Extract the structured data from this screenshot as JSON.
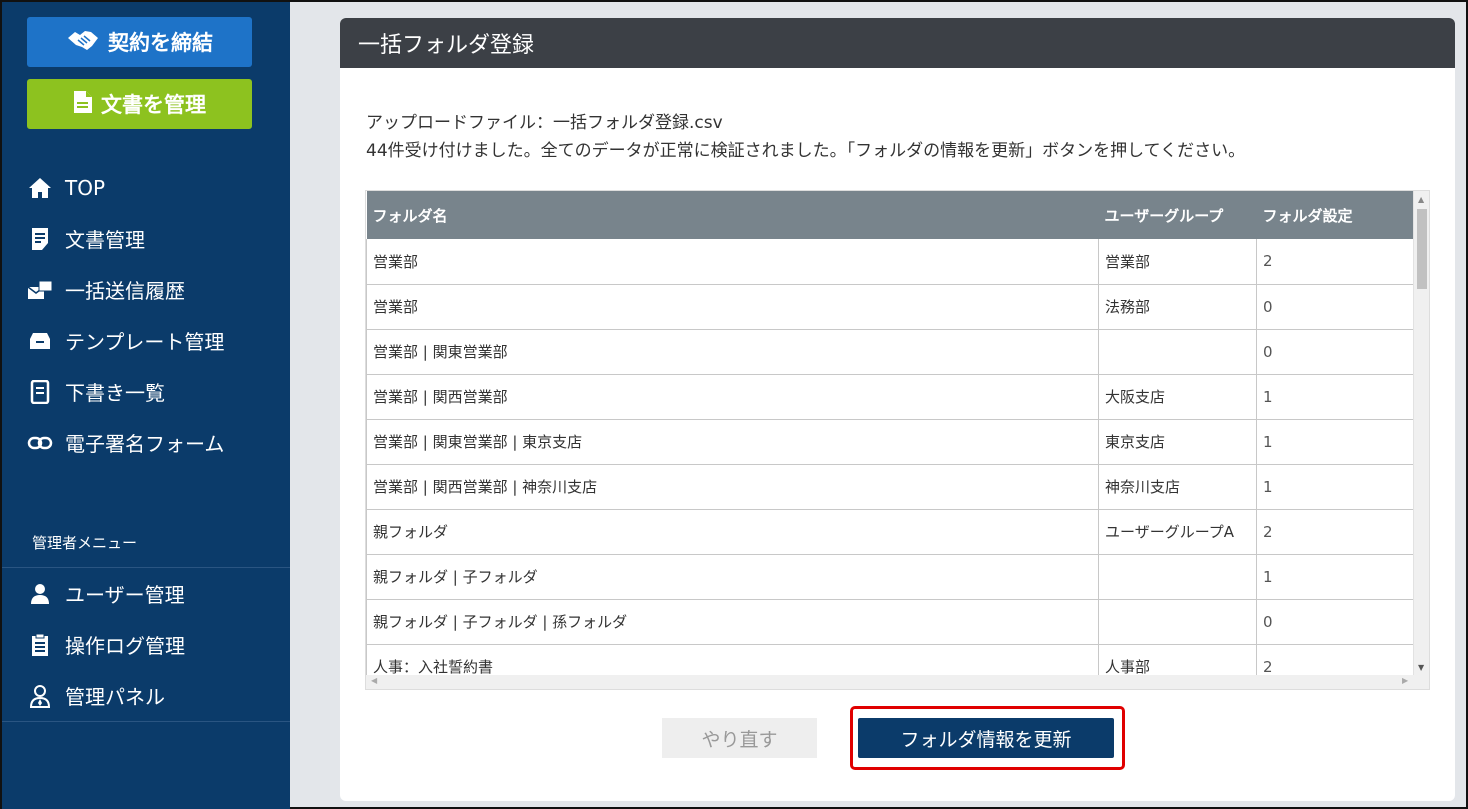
{
  "sidebar": {
    "contract_button": "契約を締結",
    "docs_button": "文書を管理",
    "nav": [
      {
        "label": "TOP",
        "icon": "home-icon"
      },
      {
        "label": "文書管理",
        "icon": "document-icon"
      },
      {
        "label": "一括送信履歴",
        "icon": "batch-send-icon"
      },
      {
        "label": "テンプレート管理",
        "icon": "template-icon"
      },
      {
        "label": "下書き一覧",
        "icon": "draft-icon"
      },
      {
        "label": "電子署名フォーム",
        "icon": "link-icon"
      }
    ],
    "admin_title": "管理者メニュー",
    "admin_nav": [
      {
        "label": "ユーザー管理",
        "icon": "user-icon"
      },
      {
        "label": "操作ログ管理",
        "icon": "log-icon"
      },
      {
        "label": "管理パネル",
        "icon": "admin-panel-icon"
      }
    ]
  },
  "panel": {
    "title": "一括フォルダ登録",
    "upload_file": "アップロードファイル：一括フォルダ登録.csv",
    "message": "44件受け付けました。全てのデータが正常に検証されました。「フォルダの情報を更新」ボタンを押してください。",
    "table": {
      "headers": [
        "フォルダ名",
        "ユーザーグループ",
        "フォルダ設定"
      ],
      "rows": [
        [
          "営業部",
          "営業部",
          "2"
        ],
        [
          "営業部",
          "法務部",
          "0"
        ],
        [
          "営業部 | 関東営業部",
          "",
          "0"
        ],
        [
          "営業部 | 関西営業部",
          "大阪支店",
          "1"
        ],
        [
          "営業部 | 関東営業部 | 東京支店",
          "東京支店",
          "1"
        ],
        [
          "営業部 | 関西営業部 | 神奈川支店",
          "神奈川支店",
          "1"
        ],
        [
          "親フォルダ",
          "ユーザーグループA",
          "2"
        ],
        [
          "親フォルダ | 子フォルダ",
          "",
          "1"
        ],
        [
          "親フォルダ | 子フォルダ | 孫フォルダ",
          "",
          "0"
        ],
        [
          "人事：入社誓約書",
          "人事部",
          "2"
        ]
      ]
    },
    "reset_button": "やり直す",
    "update_button": "フォルダ情報を更新"
  },
  "colors": {
    "sidebar_bg": "#0b3b6a",
    "contract_button": "#1e73c8",
    "docs_button": "#8dc21f",
    "header_bg": "#3c4046",
    "table_header_bg": "#78848c",
    "highlight_outline": "#e00000"
  }
}
